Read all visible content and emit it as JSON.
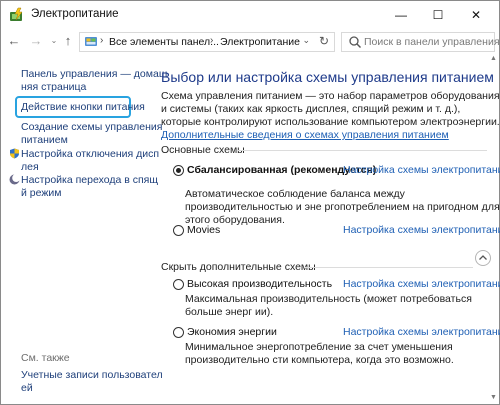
{
  "window": {
    "title": "Электропитание",
    "minimize_glyph": "—",
    "maximize_glyph": "☐",
    "close_glyph": "✕"
  },
  "nav": {
    "back_glyph": "←",
    "forward_glyph": "→",
    "history_glyph": "⌄",
    "up_glyph": "↑",
    "breadcrumb": [
      "Все элементы панел...",
      "Электропитание"
    ],
    "search_placeholder": "Поиск в панели управления"
  },
  "sidebar": {
    "home_link": [
      "Панель управления — домаш",
      "няя страница"
    ],
    "items": [
      {
        "label": "Действие кнопки питания",
        "highlighted": true
      },
      {
        "label": [
          "Создание схемы управления",
          "питанием"
        ]
      },
      {
        "label": [
          "Настройка отключения дисп",
          "лея"
        ],
        "icon": "shield-icon"
      },
      {
        "label": [
          "Настройка перехода в спящ",
          "й режим"
        ],
        "icon": "moon-icon"
      }
    ],
    "see_also_label": "См. также",
    "see_also_link": [
      "Учетные записи пользовател",
      "ей"
    ]
  },
  "main": {
    "title": "Выбор или настройка схемы управления питанием",
    "description": "Схема управления питанием — это набор параметров оборудования и системы (таких как яркость дисплея, спящий режим и т. д.), которые контролируют использование компьютером электроэнергии. ",
    "description_link": "Дополнительные сведения о схемах управления питанием",
    "main_group_label": "Основные схемы",
    "hidden_group_label": "Скрыть дополнительные схемы",
    "plans": [
      {
        "name": "Сбалансированная (рекомендуется)",
        "selected": true,
        "link": "Настройка схемы электропитания",
        "desc": "Автоматическое соблюдение баланса между производительностью и эне ргопотреблением на пригодном для этого оборудования."
      },
      {
        "name": "Movies",
        "selected": false,
        "link": "Настройка схемы электропитания",
        "desc": ""
      },
      {
        "name": "Высокая производительность",
        "selected": false,
        "link": "Настройка схемы электропитания",
        "desc": "Максимальная производительность (может потребоваться больше энерг ии)."
      },
      {
        "name": "Экономия энергии",
        "selected": false,
        "link": "Настройка схемы электропитания",
        "desc": "Минимальное энергопотребление за счет уменьшения производительно сти компьютера, когда это возможно."
      }
    ]
  },
  "colors": {
    "link": "#1e5fb4",
    "title": "#1e3a8a",
    "highlight_border": "#29a3e0"
  }
}
